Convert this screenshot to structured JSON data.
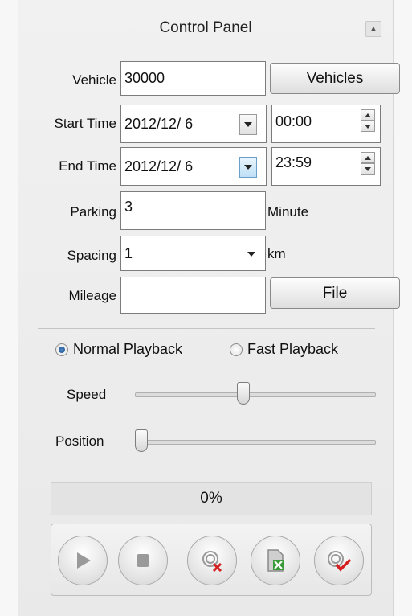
{
  "panel": {
    "title": "Control Panel",
    "collapse_glyph": "▲"
  },
  "form": {
    "vehicle_label": "Vehicle",
    "vehicle_value": "30000",
    "vehicles_button": "Vehicles",
    "start_time_label": "Start Time",
    "start_date": "2012/12/ 6",
    "start_clock": "00:00",
    "end_time_label": "End Time",
    "end_date": "2012/12/ 6",
    "end_clock": "23:59",
    "parking_label": "Parking",
    "parking_value": "3",
    "parking_unit": "Minute",
    "spacing_label": "Spacing",
    "spacing_value": "1",
    "spacing_unit": "km",
    "mileage_label": "Mileage",
    "mileage_value": "",
    "file_button": "File"
  },
  "playback": {
    "normal_label": "Normal Playback",
    "fast_label": "Fast Playback",
    "selected": "normal",
    "speed_label": "Speed",
    "speed_level": 0.45,
    "position_label": "Position",
    "position_level": 0.0,
    "progress_text": "0%",
    "progress_value": 0
  },
  "controls": {
    "icons": [
      "play-icon",
      "stop-icon",
      "clear-track-icon",
      "export-icon",
      "confirm-track-icon"
    ]
  },
  "colors": {
    "accent": "#1e4d86",
    "clear_red": "#d42020",
    "confirm_red": "#d42020",
    "export_green": "#3a9a3a"
  }
}
